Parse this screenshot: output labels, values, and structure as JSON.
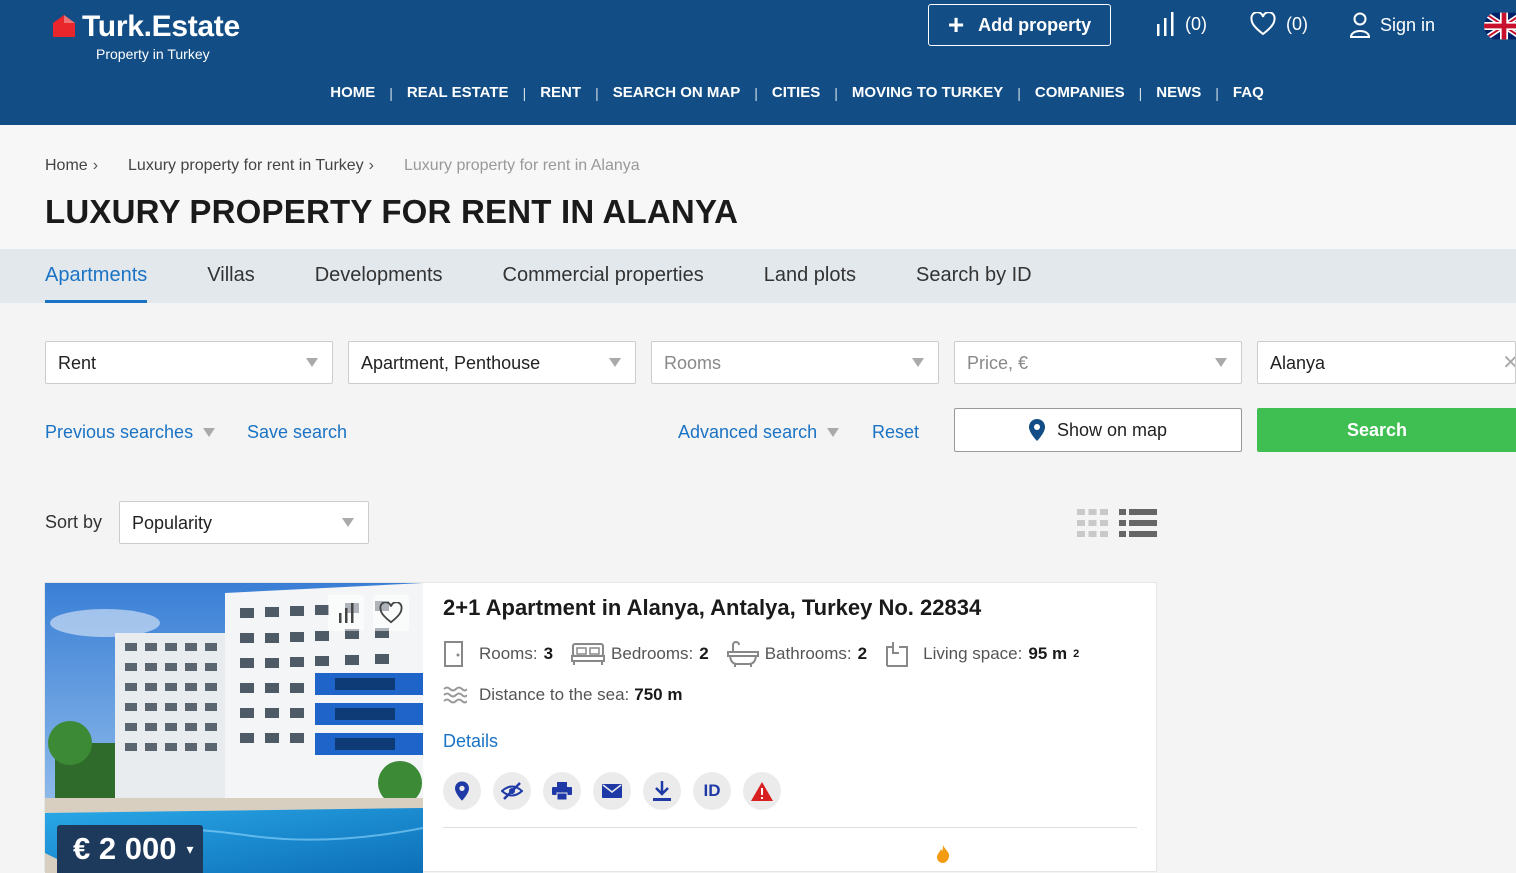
{
  "brand": {
    "name": "Turk.Estate",
    "tagline": "Property in Turkey"
  },
  "header": {
    "add_property": "Add property",
    "compare_count": "(0)",
    "favorites_count": "(0)",
    "sign_in": "Sign in",
    "language_flag": "uk-flag-icon"
  },
  "nav": [
    {
      "label": "HOME"
    },
    {
      "label": "REAL ESTATE"
    },
    {
      "label": "RENT"
    },
    {
      "label": "SEARCH ON MAP"
    },
    {
      "label": "CITIES"
    },
    {
      "label": "MOVING TO TURKEY"
    },
    {
      "label": "COMPANIES"
    },
    {
      "label": "NEWS"
    },
    {
      "label": "FAQ"
    }
  ],
  "nav_separator": "|",
  "breadcrumb": {
    "items": [
      "Home",
      "Luxury property for rent in Turkey",
      "Luxury property for rent in Alanya"
    ],
    "separator": "›"
  },
  "page_title": "LUXURY PROPERTY FOR RENT IN ALANYA",
  "tabs": [
    "Apartments",
    "Villas",
    "Developments",
    "Commercial properties",
    "Land plots",
    "Search by ID"
  ],
  "active_tab": "Apartments",
  "filters": {
    "deal": "Rent",
    "type": "Apartment, Penthouse",
    "rooms_placeholder": "Rooms",
    "price_placeholder": "Price, €",
    "location": "Alanya",
    "clear_glyph": "✕"
  },
  "links": {
    "previous_searches": "Previous searches",
    "save_search": "Save search",
    "advanced_search": "Advanced search",
    "reset": "Reset"
  },
  "buttons": {
    "show_on_map": "Show on map",
    "search": "Search"
  },
  "sort": {
    "label": "Sort by",
    "value": "Popularity"
  },
  "listing": {
    "title": "2+1 Apartment in Alanya, Antalya, Turkey No. 22834",
    "rooms_label": "Rooms:",
    "rooms": "3",
    "bedrooms_label": "Bedrooms:",
    "bedrooms": "2",
    "bathrooms_label": "Bathrooms:",
    "bathrooms": "2",
    "living_label": "Living space:",
    "living": "95 m",
    "living_sup": "2",
    "sea_label": "Distance to the sea:",
    "sea": "750 m",
    "details": "Details",
    "price": "€ 2 000",
    "price_caret": "▾",
    "id_label": "ID"
  },
  "colors": {
    "header_bg": "#124e85",
    "accent": "#1a73c4",
    "search_green": "#3fbf52",
    "price_badge": "#1d3a5c"
  }
}
